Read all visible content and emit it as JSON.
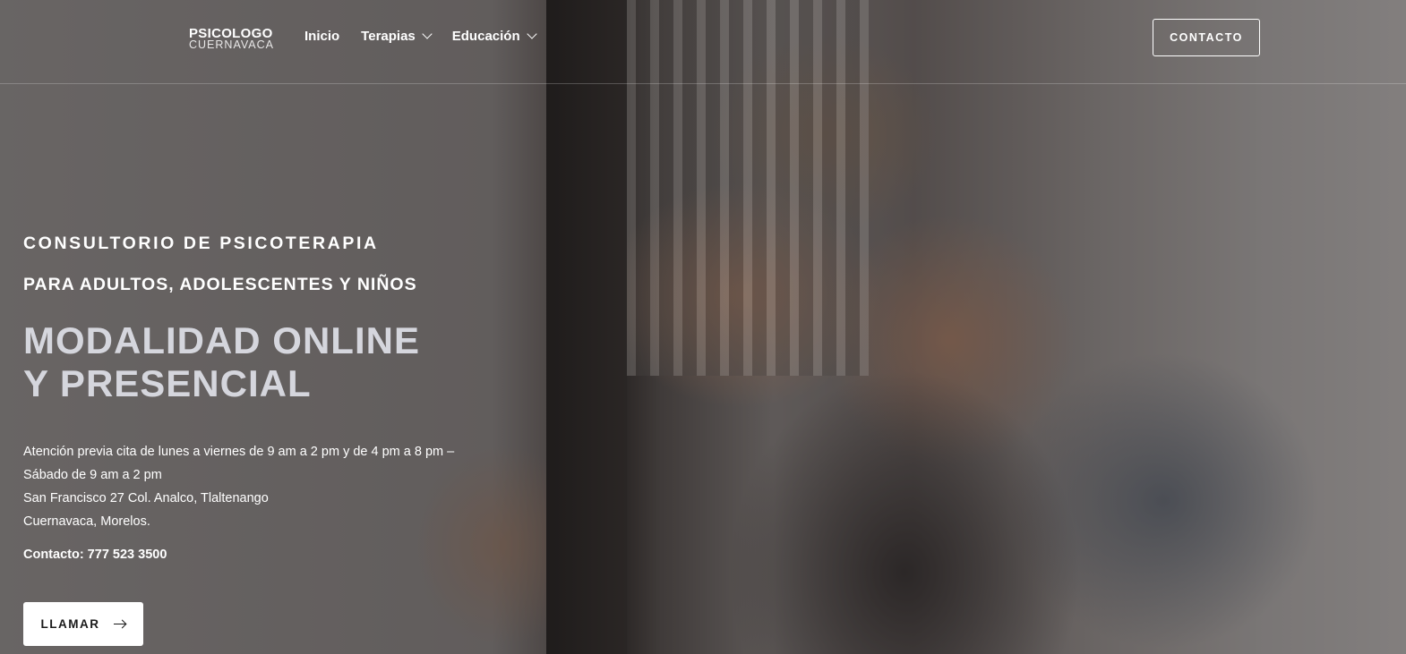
{
  "header": {
    "logo": {
      "line1": "PSICOLOGO",
      "line2": "CUERNAVACA"
    },
    "nav": [
      {
        "label": "Inicio",
        "has_dropdown": false
      },
      {
        "label": "Terapias",
        "has_dropdown": true
      },
      {
        "label": "Educación",
        "has_dropdown": true
      }
    ],
    "contact_button": "CONTACTO"
  },
  "hero": {
    "eyebrow_1": "CONSULTORIO DE PSICOTERAPIA",
    "eyebrow_2": "PARA ADULTOS, ADOLESCENTES Y NIÑOS",
    "headline_line1": "MODALIDAD ONLINE",
    "headline_line2": "Y PRESENCIAL",
    "info_lines": [
      "Atención previa cita de lunes a viernes de 9 am a 2 pm y de 4 pm a 8 pm –",
      "Sábado de 9 am a 2 pm",
      "San Francisco 27 Col. Analco, Tlaltenango",
      "Cuernavaca, Morelos."
    ],
    "phone": "Contacto: 777 523 3500",
    "call_button": "LLAMAR",
    "call_icon": "arrow-right-icon"
  },
  "colors": {
    "headline": "#d5d6dd",
    "button_bg": "#ffffff",
    "button_text": "#1a1a1a"
  }
}
